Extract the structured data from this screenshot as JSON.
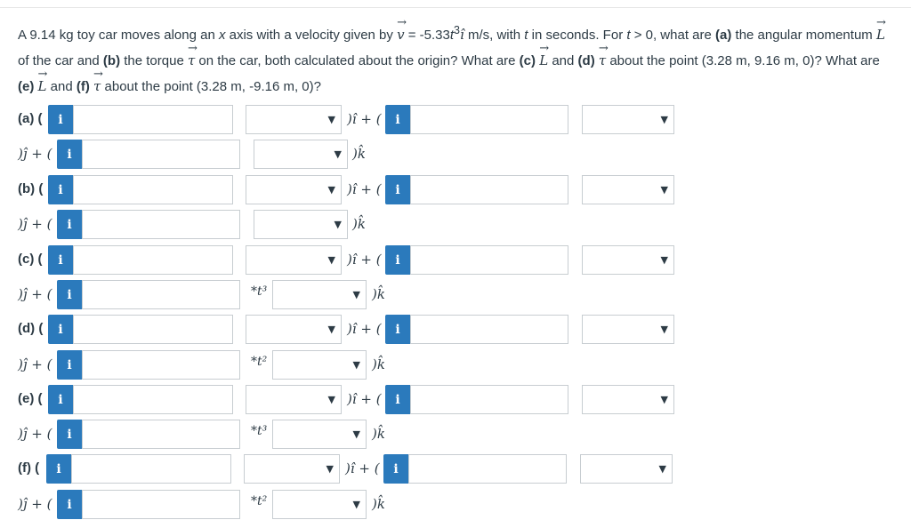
{
  "question": {
    "p1": "A 9.14 kg toy car moves along an ",
    "x_var": "x",
    "p2": " axis with a velocity given by ",
    "v_sym": "v",
    "p3": " = -5.33",
    "t_var1": "t",
    "exp3": "3",
    "ihat": "î",
    "p4": " m/s, with ",
    "t_var2": "t",
    "p5": " in seconds. For ",
    "t_var3": "t",
    "p6": " > 0, what are ",
    "a_lbl": "(a)",
    "p7": " the angular momentum ",
    "L_sym1": "L",
    "p8": " of the car and ",
    "b_lbl": "(b)",
    "p9": " the torque ",
    "tau_sym1": "τ",
    "p10": " on the car, both calculated about the origin? What are ",
    "c_lbl": "(c)",
    "L_sym2": "L",
    "p11": " and ",
    "d_lbl": "(d)",
    "tau_sym2": "τ",
    "p12": " about the point (3.28 m, 9.16 m, 0)? What are ",
    "e_lbl": "(e)",
    "L_sym3": "L",
    "p13": " and ",
    "f_lbl": "(f)",
    "tau_sym3": "τ",
    "p14": " about the point (3.28 m, -9.16 m, 0)?"
  },
  "info_icon": "i",
  "unit_i": ")î + (",
  "unit_j": ")ĵ + (",
  "unit_k": ")k̂",
  "parts": [
    {
      "label": "(a) (",
      "t_factor": ""
    },
    {
      "label": "(b) (",
      "t_factor": ""
    },
    {
      "label": "(c) (",
      "t_factor": "*t³"
    },
    {
      "label": "(d) (",
      "t_factor": "*t²"
    },
    {
      "label": "(e) (",
      "t_factor": "*t³"
    },
    {
      "label": "(f) (",
      "t_factor": "*t²"
    }
  ]
}
